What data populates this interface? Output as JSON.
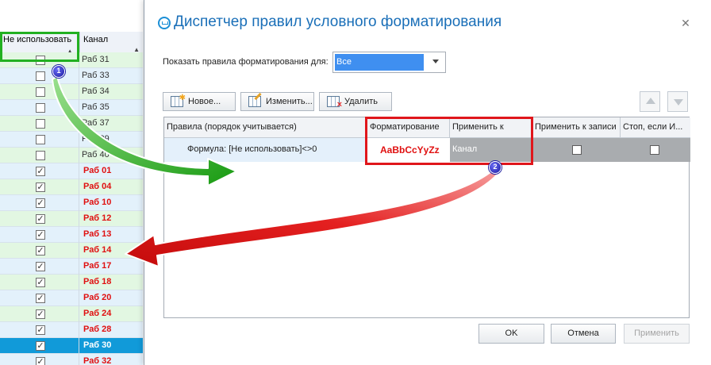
{
  "grid": {
    "col1_header": "Не использовать",
    "col2_header": "Канал",
    "rows": [
      {
        "checked": false,
        "label": "Раб 31",
        "active": false,
        "color": "green"
      },
      {
        "checked": false,
        "label": "Раб 33",
        "active": false,
        "color": "blue"
      },
      {
        "checked": false,
        "label": "Раб 34",
        "active": false,
        "color": "green"
      },
      {
        "checked": false,
        "label": "Раб 35",
        "active": false,
        "color": "blue"
      },
      {
        "checked": false,
        "label": "Раб 37",
        "active": false,
        "color": "green"
      },
      {
        "checked": false,
        "label": "Раб 39",
        "active": false,
        "color": "blue"
      },
      {
        "checked": false,
        "label": "Раб 40",
        "active": false,
        "color": "green"
      },
      {
        "checked": true,
        "label": "Раб 01",
        "active": true,
        "color": "blue"
      },
      {
        "checked": true,
        "label": "Раб 04",
        "active": true,
        "color": "green"
      },
      {
        "checked": true,
        "label": "Раб 10",
        "active": true,
        "color": "blue"
      },
      {
        "checked": true,
        "label": "Раб 12",
        "active": true,
        "color": "green"
      },
      {
        "checked": true,
        "label": "Раб 13",
        "active": true,
        "color": "blue"
      },
      {
        "checked": true,
        "label": "Раб 14",
        "active": true,
        "color": "green"
      },
      {
        "checked": true,
        "label": "Раб 17",
        "active": true,
        "color": "blue"
      },
      {
        "checked": true,
        "label": "Раб 18",
        "active": true,
        "color": "green"
      },
      {
        "checked": true,
        "label": "Раб 20",
        "active": true,
        "color": "blue"
      },
      {
        "checked": true,
        "label": "Раб 24",
        "active": true,
        "color": "green"
      },
      {
        "checked": true,
        "label": "Раб 28",
        "active": true,
        "color": "blue"
      },
      {
        "checked": true,
        "label": "Раб 30",
        "active": true,
        "color": "selected"
      },
      {
        "checked": true,
        "label": "Раб 32",
        "active": true,
        "color": "blue"
      }
    ]
  },
  "dialog": {
    "title": "Диспетчер правил условного форматирования",
    "show_rules_label": "Показать правила форматирования для:",
    "show_rules_value": "Все",
    "toolbar": {
      "new_label": "Новое...",
      "edit_label": "Изменить...",
      "delete_label": "Удалить"
    },
    "columns": {
      "rules": "Правила (порядок учитывается)",
      "format": "Форматирование",
      "apply_to": "Применить к",
      "apply_to_record": "Применить к записи",
      "stop_if": "Стоп, если И..."
    },
    "rule": {
      "formula": "Формула: [Не использовать]<>0",
      "preview": "AaBbCcYyZz",
      "apply_to": "Канал",
      "apply_to_record": false,
      "stop_if": false
    },
    "buttons": {
      "ok": "OK",
      "cancel": "Отмена",
      "apply": "Применить"
    }
  },
  "annotations": {
    "badge1": "1",
    "badge2": "2"
  },
  "colors": {
    "green_highlight": "#22b021",
    "red_highlight": "#e0161b",
    "title": "#1a6fb8",
    "selected_row": "#119ad9",
    "active_text": "#e01010",
    "badge": "#1a1aa0"
  }
}
